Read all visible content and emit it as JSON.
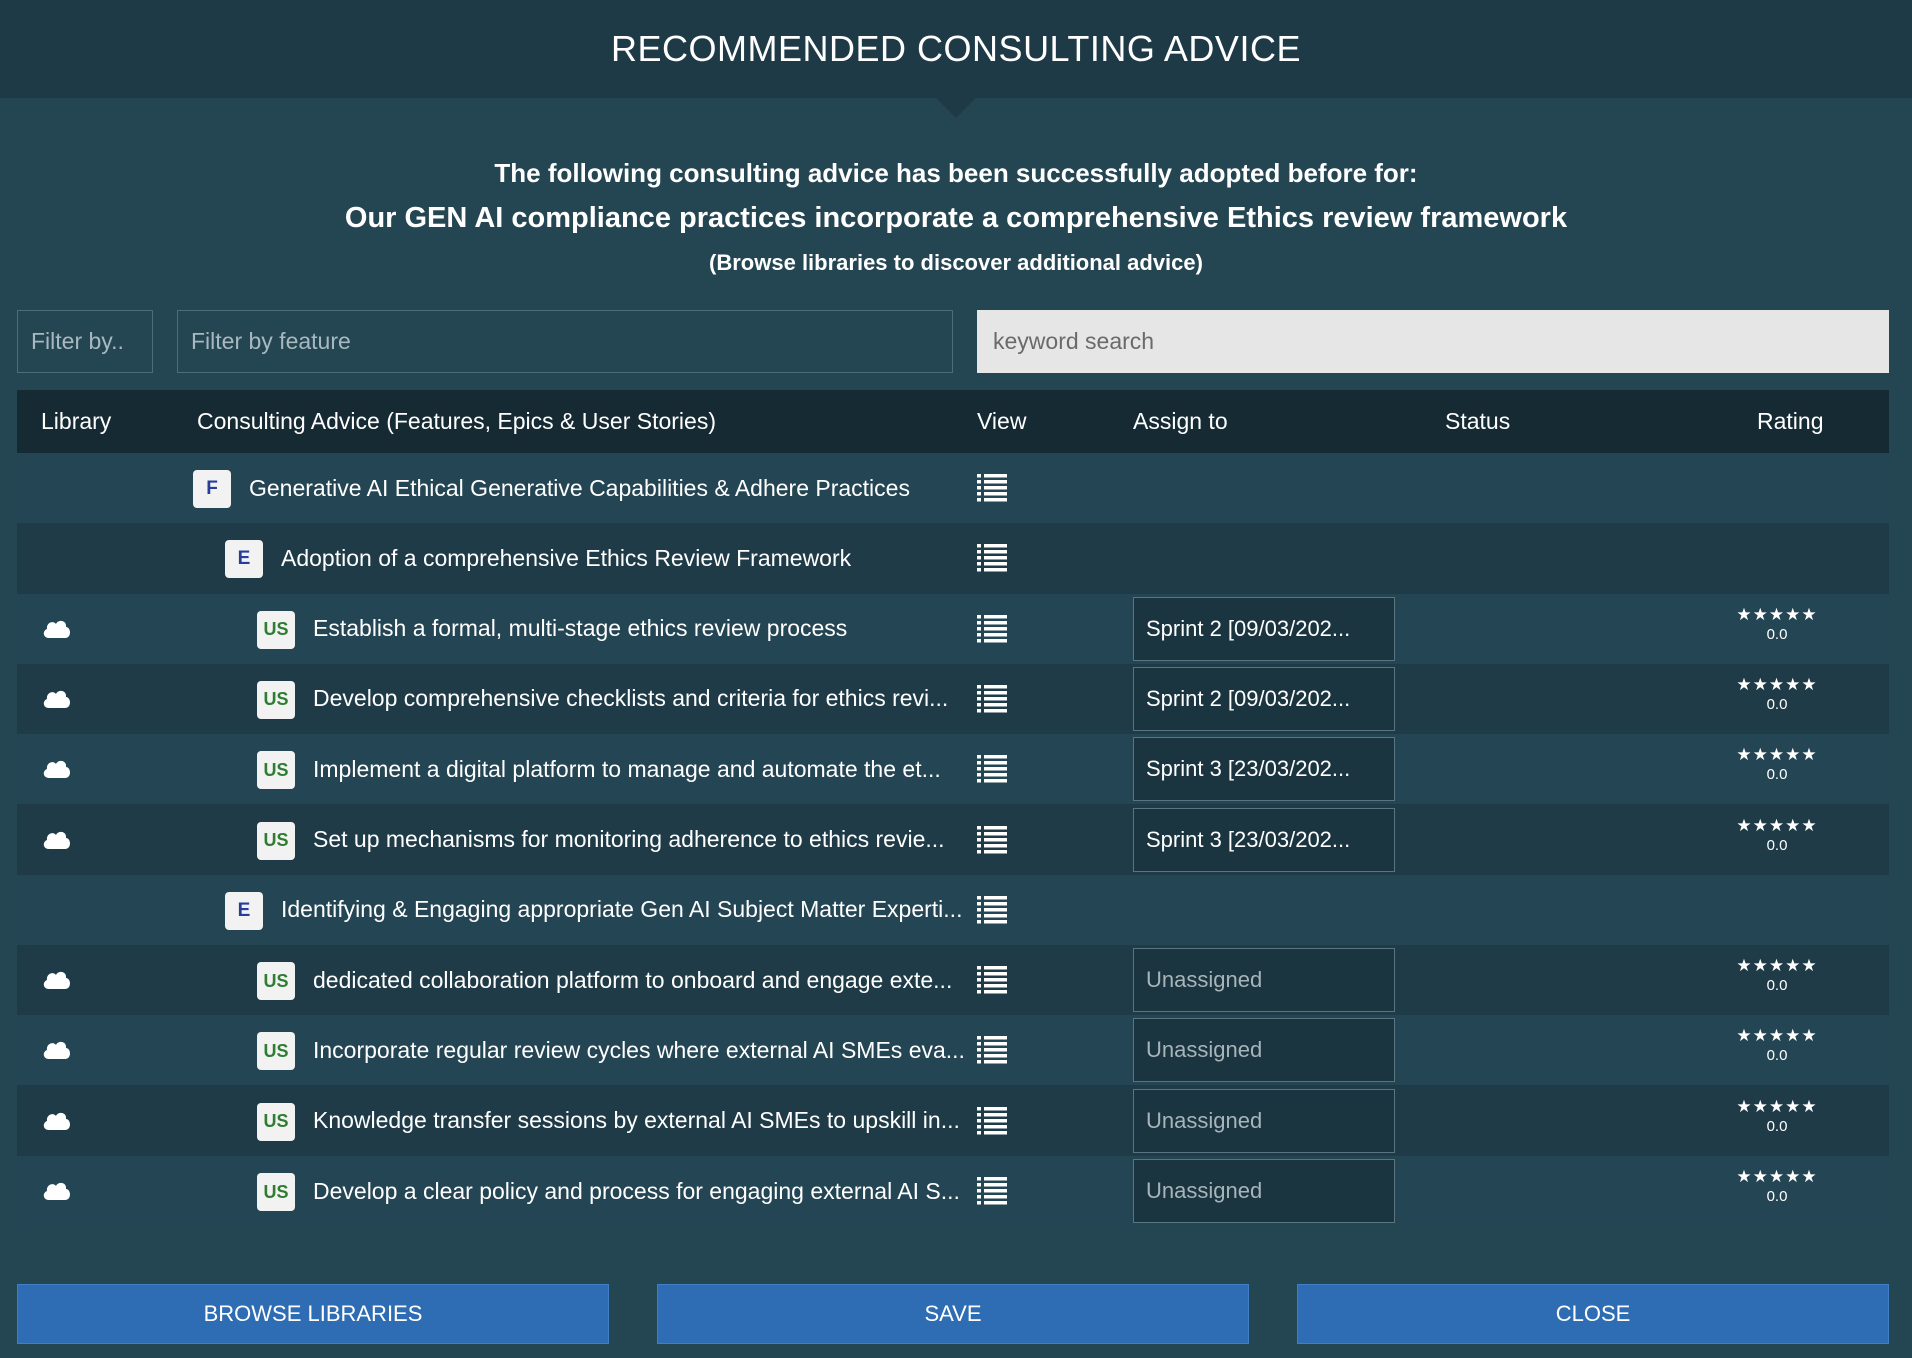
{
  "header": {
    "title": "RECOMMENDED CONSULTING ADVICE"
  },
  "intro": {
    "line1": "The following consulting advice has been successfully adopted before for:",
    "line2": "Our GEN AI compliance practices incorporate a comprehensive Ethics review framework",
    "line3": "(Browse libraries to discover additional advice)"
  },
  "filters": {
    "library_filter": "Filter by..",
    "feature_filter": "Filter by feature",
    "search_placeholder": "keyword search"
  },
  "columns": {
    "library": "Library",
    "advice": "Consulting Advice (Features, Epics & User Stories)",
    "view": "View",
    "assign": "Assign to",
    "status": "Status",
    "rating": "Rating"
  },
  "rows": [
    {
      "type": "F",
      "badge": "F",
      "label": "Generative AI Ethical Generative Capabilities & Adhere Practices"
    },
    {
      "type": "E",
      "badge": "E",
      "label": "Adoption of a comprehensive Ethics Review Framework"
    },
    {
      "type": "US",
      "badge": "US",
      "label": "Establish a formal, multi-stage ethics review process",
      "assign": "Sprint 2 [09/03/202...",
      "assigned": true,
      "stars": "★★★★★",
      "rating": "0.0"
    },
    {
      "type": "US",
      "badge": "US",
      "label": "Develop comprehensive checklists and criteria for ethics revi...",
      "assign": "Sprint 2 [09/03/202...",
      "assigned": true,
      "stars": "★★★★★",
      "rating": "0.0"
    },
    {
      "type": "US",
      "badge": "US",
      "label": "Implement a digital platform to manage and automate the et...",
      "assign": "Sprint 3 [23/03/202...",
      "assigned": true,
      "stars": "★★★★★",
      "rating": "0.0"
    },
    {
      "type": "US",
      "badge": "US",
      "label": "Set up mechanisms for monitoring adherence to ethics revie...",
      "assign": "Sprint 3 [23/03/202...",
      "assigned": true,
      "stars": "★★★★★",
      "rating": "0.0"
    },
    {
      "type": "E",
      "badge": "E",
      "label": "Identifying & Engaging appropriate Gen AI Subject Matter Experti..."
    },
    {
      "type": "US",
      "badge": "US",
      "label": "dedicated collaboration platform to onboard and engage exte...",
      "assign": "Unassigned",
      "assigned": false,
      "stars": "★★★★★",
      "rating": "0.0"
    },
    {
      "type": "US",
      "badge": "US",
      "label": "Incorporate regular review cycles where external AI SMEs eva...",
      "assign": "Unassigned",
      "assigned": false,
      "stars": "★★★★★",
      "rating": "0.0"
    },
    {
      "type": "US",
      "badge": "US",
      "label": "Knowledge transfer sessions by external AI SMEs to upskill in...",
      "assign": "Unassigned",
      "assigned": false,
      "stars": "★★★★★",
      "rating": "0.0"
    },
    {
      "type": "US",
      "badge": "US",
      "label": "Develop a clear policy and process for engaging external AI S...",
      "assign": "Unassigned",
      "assigned": false,
      "stars": "★★★★★",
      "rating": "0.0"
    }
  ],
  "buttons": {
    "browse": "BROWSE LIBRARIES",
    "save": "SAVE",
    "close": "CLOSE"
  }
}
